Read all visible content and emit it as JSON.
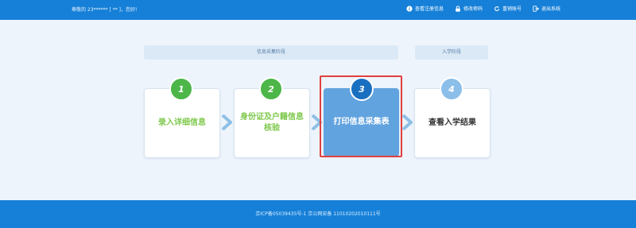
{
  "header": {
    "greeting": "尊敬的 23****** [ ** ]，您好!",
    "nav": [
      {
        "label": "查看注册信息",
        "icon": "info-icon"
      },
      {
        "label": "修改密码",
        "icon": "lock-icon"
      },
      {
        "label": "重销账号",
        "icon": "refresh-icon"
      },
      {
        "label": "退出系统",
        "icon": "logout-icon"
      }
    ]
  },
  "stages": {
    "collect": "信息采集阶段",
    "enroll": "入学阶段"
  },
  "steps": [
    {
      "number": "1",
      "label": "录入详细信息",
      "state": "done"
    },
    {
      "number": "2",
      "label": "身份证及户籍信息核验",
      "state": "done"
    },
    {
      "number": "3",
      "label": "打印信息采集表",
      "state": "active"
    },
    {
      "number": "4",
      "label": "查看入学结果",
      "state": "next"
    }
  ],
  "footer": {
    "text": "京ICP备05039435号-1 京公网安备 11010202010111号"
  },
  "colors": {
    "primary": "#1680d8",
    "done": "#4cb648",
    "active": "#61a3df",
    "highlight": "#e04040"
  }
}
